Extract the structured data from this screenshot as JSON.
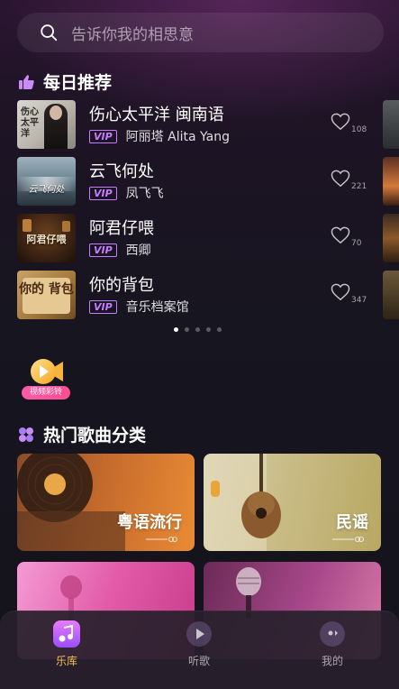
{
  "search": {
    "placeholder": "告诉你我的相思意"
  },
  "daily": {
    "title": "每日推荐",
    "songs": [
      {
        "title": "伤心太平洋 闽南语",
        "artist": "阿丽塔 Alita Yang",
        "vip": "VIP",
        "likes": "108",
        "cover_text": "伤心 太平洋"
      },
      {
        "title": "云飞何处",
        "artist": "凤飞飞",
        "vip": "VIP",
        "likes": "221",
        "cover_text": "云飞何处"
      },
      {
        "title": "阿君仔喂",
        "artist": "西卿",
        "vip": "VIP",
        "likes": "70",
        "cover_text": "阿君仔喂"
      },
      {
        "title": "你的背包",
        "artist": "音乐档案馆",
        "vip": "VIP",
        "likes": "347",
        "cover_text": "你的 背包"
      }
    ],
    "page_indicator": {
      "pages": 5,
      "active": 1
    }
  },
  "video_badge": {
    "label": "视频彩铃"
  },
  "categories": {
    "title": "热门歌曲分类",
    "items": [
      {
        "label": "粤语流行"
      },
      {
        "label": "民谣"
      }
    ]
  },
  "tabbar": {
    "tabs": [
      {
        "label": "乐库",
        "active": true
      },
      {
        "label": "听歌",
        "active": false
      },
      {
        "label": "我的",
        "active": false
      }
    ]
  },
  "colors": {
    "accent": "#f6c04c",
    "vip": "#c77cff",
    "badge": "#ff5aa8"
  }
}
